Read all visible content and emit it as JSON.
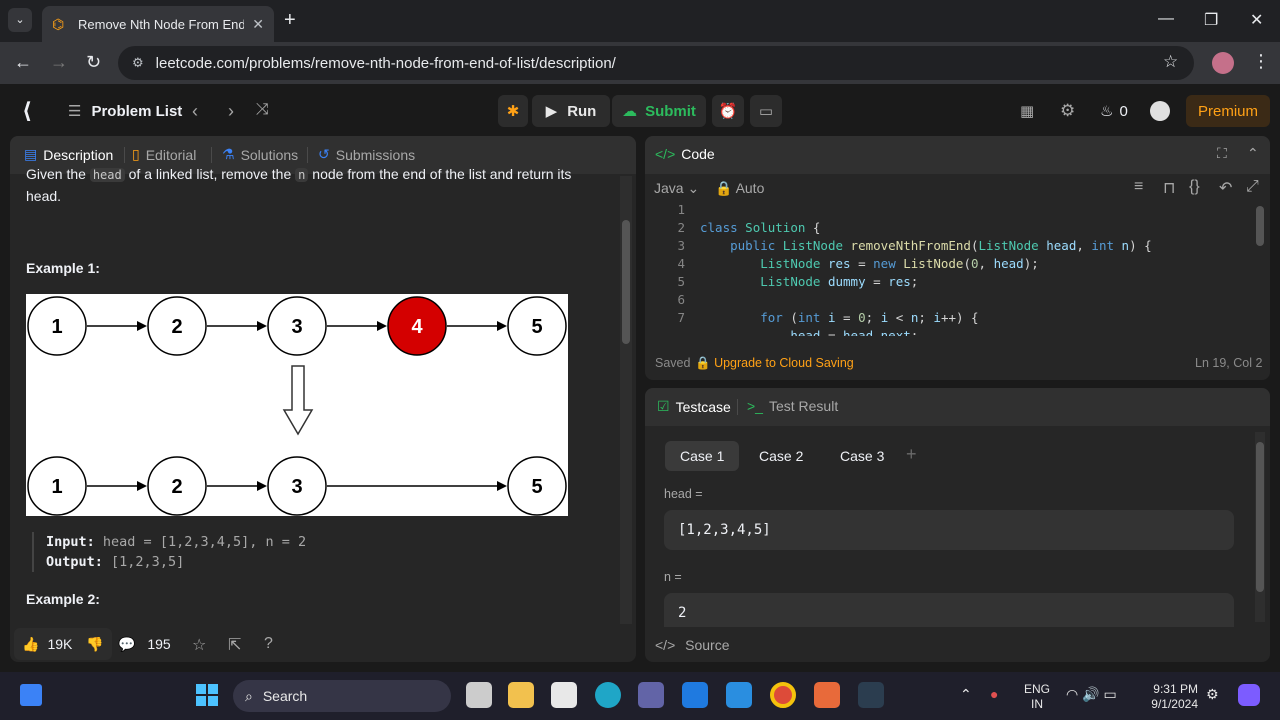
{
  "browser": {
    "tab_title": "Remove Nth Node From End of",
    "url": "leetcode.com/problems/remove-nth-node-from-end-of-list/description/"
  },
  "header": {
    "problem_list": "Problem List",
    "run": "Run",
    "submit": "Submit",
    "streak": "0",
    "premium": "Premium"
  },
  "left_tabs": [
    "Description",
    "Editorial",
    "Solutions",
    "Submissions"
  ],
  "description": {
    "line1_a": "Given the",
    "code_head": "head",
    "line1_b": "of a linked list, remove the",
    "code_n": "n",
    "line1_c": "node from the end of the list and return its",
    "line2": "head.",
    "example1": "Example 1:",
    "input_label": "Input:",
    "input_value": "head = [1,2,3,4,5], n = 2",
    "output_label": "Output:",
    "output_value": "[1,2,3,5]",
    "example2": "Example 2:",
    "diagram_top": [
      "1",
      "2",
      "3",
      "4",
      "5"
    ],
    "diagram_bottom": [
      "1",
      "2",
      "3",
      "5"
    ]
  },
  "footer": {
    "likes": "19K",
    "comments": "195"
  },
  "code": {
    "title": "Code",
    "language": "Java",
    "mode": "Auto",
    "lines": [
      "1",
      "2",
      "3",
      "4",
      "5",
      "6",
      "7"
    ],
    "saved": "Saved",
    "upgrade": "Upgrade to Cloud Saving",
    "position": "Ln 19, Col 2"
  },
  "testcase": {
    "tab1": "Testcase",
    "tab2": "Test Result",
    "cases": [
      "Case 1",
      "Case 2",
      "Case 3"
    ],
    "head_label": "head =",
    "head_value": "[1,2,3,4,5]",
    "n_label": "n =",
    "n_value": "2",
    "source": "Source"
  },
  "taskbar": {
    "search": "Search",
    "lang1": "ENG",
    "lang2": "IN",
    "time": "9:31 PM",
    "date": "9/1/2024"
  },
  "colors": {
    "accent": "#ffa116",
    "green": "#2cbb5d",
    "red_node": "#d40000"
  }
}
